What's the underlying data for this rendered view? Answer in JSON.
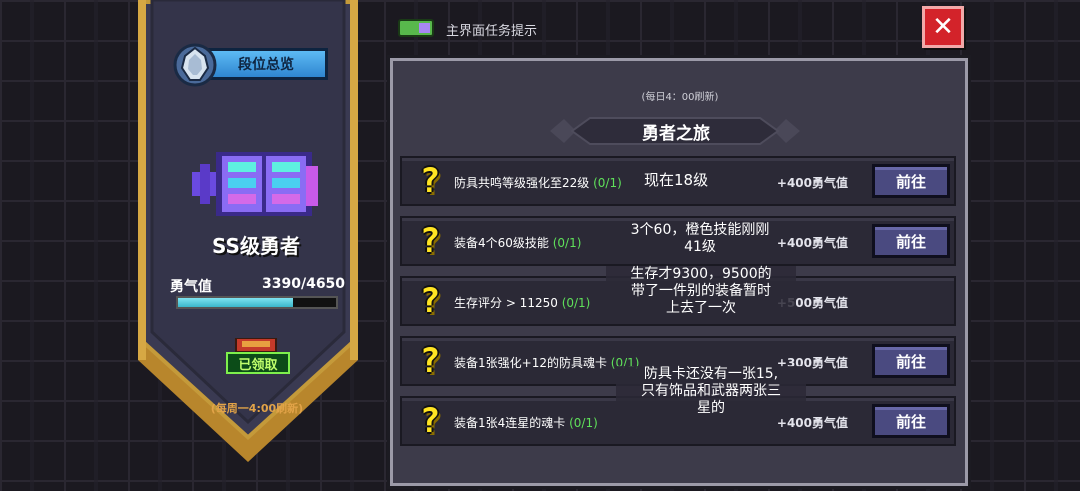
{
  "left_panel": {
    "rank_overview_label": "段位总览",
    "rank_title": "SS级勇者",
    "courage_label": "勇气值",
    "courage_value": "3390/4650",
    "courage_progress": 0.729,
    "claimed_label": "已领取",
    "weekly_refresh": "(每周一4:00刷新)"
  },
  "top_bar": {
    "toggle_label": "主界面任务提示",
    "toggle_on": true,
    "close_label": "✕"
  },
  "panel": {
    "daily_refresh": "(每日4：00刷新)",
    "title": "勇者之旅"
  },
  "tasks": [
    {
      "text": "防具共鸣等级强化至22级",
      "progress": "(0/1)",
      "reward": "+400勇气值",
      "button": "前往",
      "has_button": true
    },
    {
      "text": "装备4个60级技能",
      "progress": "(0/1)",
      "reward": "+400勇气值",
      "button": "前往",
      "has_button": true
    },
    {
      "text": "生存评分 > 11250",
      "progress": "(0/1)",
      "reward": "+500勇气值",
      "button": "",
      "has_button": false
    },
    {
      "text": "装备1张强化+12的防具魂卡",
      "progress": "(0/1)",
      "reward": "+300勇气值",
      "button": "前往",
      "has_button": true
    },
    {
      "text": "装备1张4连星的魂卡",
      "progress": "(0/1)",
      "reward": "+400勇气值",
      "button": "前往",
      "has_button": true
    }
  ],
  "notes": {
    "n1": "现在18级",
    "n2_line1": "3个60，橙色技能刚刚",
    "n2_line2": "41级",
    "n3_line1": "生存才9300，9500的",
    "n3_line2": "带了一件别的装备暂时",
    "n3_line3": "上去了一次",
    "n4_line1": "防具卡还没有一张15,",
    "n4_line2": "只有饰品和武器两张三",
    "n4_line3": "星的"
  },
  "colors": {
    "accent_gold": "#e2a348",
    "progress_green": "#5fe05a",
    "close_red": "#d3232a",
    "button_purple": "#4a4a80",
    "courage_fill": "#3ab7c9"
  }
}
